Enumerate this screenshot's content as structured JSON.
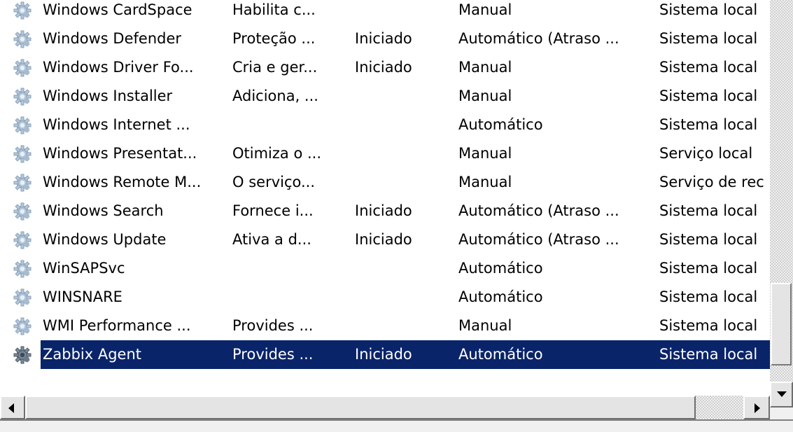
{
  "services": [
    {
      "name": "Windows CardSpace",
      "description": "Habilita c...",
      "status": "",
      "startup": "Manual",
      "logon": "Sistema local",
      "icon": "service-gear-icon"
    },
    {
      "name": "Windows Defender",
      "description": "Proteção ...",
      "status": "Iniciado",
      "startup": "Automático (Atraso ...",
      "logon": "Sistema local",
      "icon": "service-gear-icon"
    },
    {
      "name": "Windows Driver Fo...",
      "description": "Cria e ger...",
      "status": "Iniciado",
      "startup": "Manual",
      "logon": "Sistema local",
      "icon": "service-gear-icon"
    },
    {
      "name": "Windows Installer",
      "description": "Adiciona, ...",
      "status": "",
      "startup": "Manual",
      "logon": "Sistema local",
      "icon": "service-gear-icon"
    },
    {
      "name": "Windows Internet ...",
      "description": "",
      "status": "",
      "startup": "Automático",
      "logon": "Sistema local",
      "icon": "service-gear-icon"
    },
    {
      "name": "Windows Presentat...",
      "description": "Otimiza o ...",
      "status": "",
      "startup": "Manual",
      "logon": "Serviço local",
      "icon": "service-gear-icon"
    },
    {
      "name": "Windows Remote M...",
      "description": "O serviço...",
      "status": "",
      "startup": "Manual",
      "logon": "Serviço de rec",
      "icon": "service-gear-icon"
    },
    {
      "name": "Windows Search",
      "description": "Fornece i...",
      "status": "Iniciado",
      "startup": "Automático (Atraso ...",
      "logon": "Sistema local",
      "icon": "service-gear-icon"
    },
    {
      "name": "Windows Update",
      "description": "Ativa a d...",
      "status": "Iniciado",
      "startup": "Automático (Atraso ...",
      "logon": "Sistema local",
      "icon": "service-gear-icon"
    },
    {
      "name": "WinSAPSvc",
      "description": "",
      "status": "",
      "startup": "Automático",
      "logon": "Sistema local",
      "icon": "service-gear-icon"
    },
    {
      "name": "WINSNARE",
      "description": "",
      "status": "",
      "startup": "Automático",
      "logon": "Sistema local",
      "icon": "service-gear-icon"
    },
    {
      "name": "WMI Performance ...",
      "description": "Provides ...",
      "status": "",
      "startup": "Manual",
      "logon": "Sistema local",
      "icon": "service-gear-icon"
    },
    {
      "name": "Zabbix Agent",
      "description": "Provides ...",
      "status": "Iniciado",
      "startup": "Automático",
      "logon": "Sistema local",
      "icon": "service-gear-icon",
      "selected": true
    }
  ],
  "colors": {
    "selection": "#0a246a",
    "selection_text": "#ffffff"
  }
}
